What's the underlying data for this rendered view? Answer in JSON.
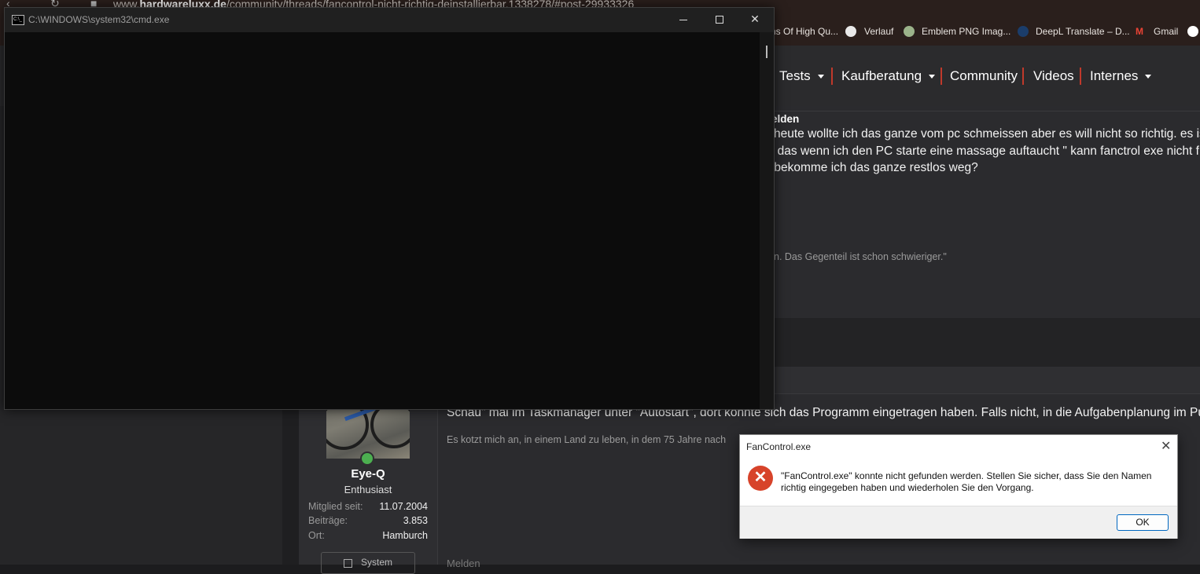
{
  "browser": {
    "url_prefix": "www.",
    "url_domain": "hardwareluxx.de",
    "url_path": "/community/threads/fancontrol-nicht-richtig-deinstallierbar.1338278/#post-29933326",
    "bookmarks": [
      {
        "label": "ns Of High Qu..."
      },
      {
        "label": "Verlauf"
      },
      {
        "label": "Emblem PNG Imag..."
      },
      {
        "label": "DeepL Translate – D..."
      },
      {
        "label": "Gmail"
      }
    ]
  },
  "site_nav": {
    "items": [
      {
        "label": "Tests",
        "dropdown": true
      },
      {
        "label": "Kaufberatung",
        "dropdown": true
      },
      {
        "label": "Community",
        "dropdown": false
      },
      {
        "label": "Videos",
        "dropdown": false
      },
      {
        "label": "Internes",
        "dropdown": true
      }
    ],
    "separator_color": "#c0392b"
  },
  "thread": {
    "post1": {
      "header_fragment": "melden",
      "lines": [
        "heute wollte ich das ganze vom pc schmeissen aber es will nicht so richtig. es ist",
        "so das wenn ich den PC starte eine massage auftaucht \" kann fanctrol exe nicht f",
        "ie bekomme ich das ganze restlos weg?"
      ],
      "signature_fragment": "n. Das Gegenteil ist schon schwieriger.\""
    },
    "post2": {
      "text": "Schau\" mal im Taskmanager unter \"Autostart\", dort könnte sich das Programm eingetragen haben. Falls nicht, in die Aufgabenplanung im Pun",
      "signature": "Es kotzt mich an, in einem Land zu leben, in dem 75 Jahre nach",
      "report_label": "Melden",
      "user": {
        "name": "Eye-Q",
        "title": "Enthusiast",
        "stats": [
          {
            "key": "Mitglied seit:",
            "value": "11.07.2004"
          },
          {
            "key": "Beiträge:",
            "value": "3.853"
          },
          {
            "key": "Ort:",
            "value": "Hamburch"
          }
        ],
        "system_button": "System"
      }
    }
  },
  "cmd_window": {
    "title": "C:\\WINDOWS\\system32\\cmd.exe",
    "icon_text": "C:\\_",
    "close_glyph": "✕"
  },
  "dialog": {
    "title": "FanControl.exe",
    "close_glyph": "✕",
    "error_glyph": "✕",
    "message": "\"FanControl.exe\" konnte nicht gefunden werden. Stellen Sie sicher, dass Sie den Namen richtig eingegeben haben und wiederholen Sie den Vorgang.",
    "ok_label": "OK"
  }
}
